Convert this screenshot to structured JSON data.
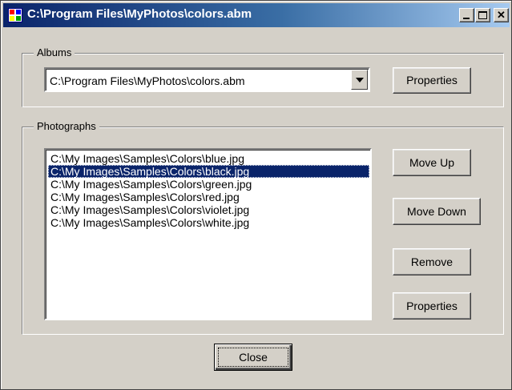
{
  "window": {
    "title": "C:\\Program Files\\MyPhotos\\colors.abm",
    "app_icon": "photo-album-icon",
    "caption_buttons": {
      "minimize": "minimize-icon",
      "maximize": "maximize-icon",
      "close": "close-icon",
      "close_glyph": "✕"
    }
  },
  "albums": {
    "label": "Albums",
    "selected_album": "C:\\Program Files\\MyPhotos\\colors.abm",
    "properties_button": "Properties"
  },
  "photographs": {
    "label": "Photographs",
    "items": [
      "C:\\My Images\\Samples\\Colors\\blue.jpg",
      "C:\\My Images\\Samples\\Colors\\black.jpg",
      "C:\\My Images\\Samples\\Colors\\green.jpg",
      "C:\\My Images\\Samples\\Colors\\red.jpg",
      "C:\\My Images\\Samples\\Colors\\violet.jpg",
      "C:\\My Images\\Samples\\Colors\\white.jpg"
    ],
    "selected_index": 1,
    "buttons": {
      "move_up": "Move Up",
      "move_down": "Move Down",
      "remove": "Remove",
      "properties": "Properties"
    }
  },
  "close_button": "Close",
  "colors": {
    "face": "#d4d0c8",
    "title_active_start": "#0a246a",
    "title_active_end": "#a6caf0",
    "selection": "#0a246a"
  }
}
